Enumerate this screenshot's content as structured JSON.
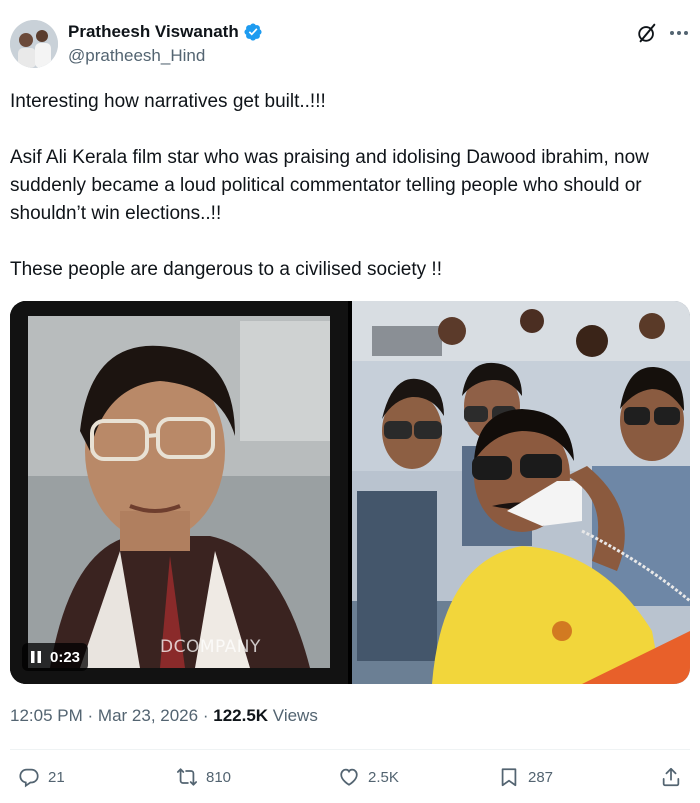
{
  "author": {
    "display_name": "Pratheesh Viswanath",
    "handle": "@pratheesh_Hind"
  },
  "tweet": {
    "paragraphs": [
      "Interesting how narratives get built..!!!",
      "Asif Ali Kerala film star who was praising and idolising Dawood ibrahim, now suddenly became a loud political commentator telling people who should or shouldn’t win elections..!!",
      "These people are dangerous to a civilised society !!"
    ]
  },
  "media": {
    "video_time": "0:23",
    "watermark": "DCOMPANY"
  },
  "meta": {
    "time": "12:05 PM",
    "sep1": "·",
    "date": "Mar 23, 2026",
    "sep2": "·",
    "views_count": "122.5K",
    "views_label": "Views"
  },
  "actions": {
    "replies": "21",
    "reposts": "810",
    "likes": "2.5K",
    "bookmarks": "287"
  },
  "colors": {
    "text": "#0f1419",
    "secondary": "#536471",
    "verified": "#1d9bf0"
  },
  "icons": [
    "verified-badge-icon",
    "grok-icon",
    "more-icon",
    "pause-icon",
    "reply-icon",
    "repost-icon",
    "like-icon",
    "bookmark-icon",
    "share-icon"
  ]
}
